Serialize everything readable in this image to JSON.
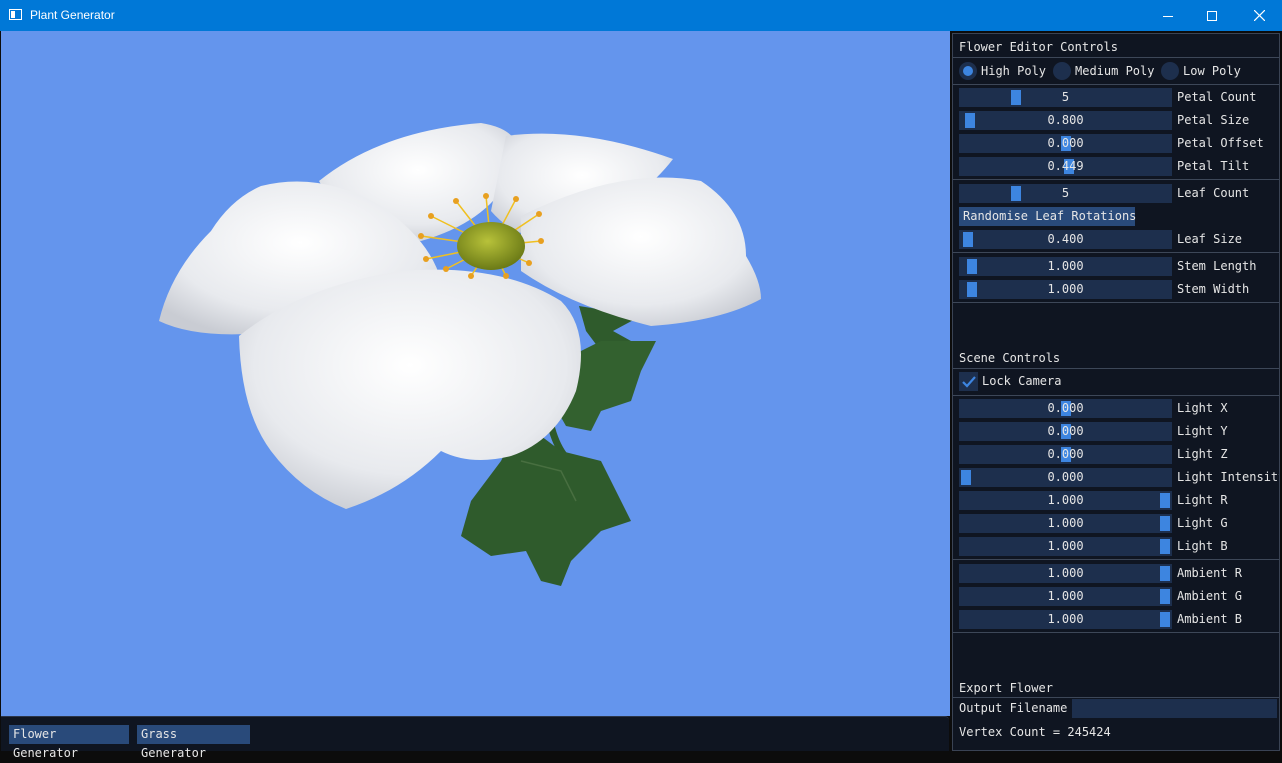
{
  "window": {
    "title": "Plant Generator"
  },
  "panel": {
    "flower_title": "Flower Editor Controls",
    "poly": [
      {
        "label": "High Poly",
        "selected": true
      },
      {
        "label": "Medium Poly",
        "selected": false
      },
      {
        "label": "Low Poly",
        "selected": false
      }
    ],
    "flower_sliders": [
      {
        "label": "Petal Count",
        "value": "5",
        "fraction": 0.25
      },
      {
        "label": "Petal Size",
        "value": "0.800",
        "fraction": 0.02
      },
      {
        "label": "Petal Offset",
        "value": "0.000",
        "fraction": 0.5
      },
      {
        "label": "Petal Tilt",
        "value": "0.449",
        "fraction": 0.52
      },
      {
        "label": "Leaf Count",
        "value": "5",
        "fraction": 0.25
      },
      {
        "label": "Leaf Size",
        "value": "0.400",
        "fraction": 0.01
      },
      {
        "label": "Stem Length",
        "value": "1.000",
        "fraction": 0.03
      },
      {
        "label": "Stem Width",
        "value": "1.000",
        "fraction": 0.03
      }
    ],
    "randomise_label": "Randomise Leaf Rotations",
    "scene_title": "Scene Controls",
    "lock_camera": {
      "label": "Lock Camera",
      "checked": true
    },
    "scene_sliders": [
      {
        "label": "Light X",
        "value": "0.000",
        "fraction": 0.5
      },
      {
        "label": "Light Y",
        "value": "0.000",
        "fraction": 0.5
      },
      {
        "label": "Light Z",
        "value": "0.000",
        "fraction": 0.5
      },
      {
        "label": "Light Intensity",
        "value": "0.000",
        "fraction": 0.0
      },
      {
        "label": "Light R",
        "value": "1.000",
        "fraction": 1.0
      },
      {
        "label": "Light G",
        "value": "1.000",
        "fraction": 1.0
      },
      {
        "label": "Light B",
        "value": "1.000",
        "fraction": 1.0
      },
      {
        "label": "Ambient R",
        "value": "1.000",
        "fraction": 1.0
      },
      {
        "label": "Ambient G",
        "value": "1.000",
        "fraction": 1.0
      },
      {
        "label": "Ambient B",
        "value": "1.000",
        "fraction": 1.0
      }
    ],
    "export_title": "Export Flower",
    "output_filename_label": "Output Filename",
    "output_filename_value": "",
    "vertex_count": "Vertex Count = 245424"
  },
  "bottom": {
    "flower_btn": "Flower Generator",
    "grass_btn": "Grass Generator"
  },
  "colors": {
    "viewport_bg": "#6495ed",
    "accent": "#3d85e0",
    "panel_bg": "#0f1521",
    "titlebar": "#0078d7"
  }
}
